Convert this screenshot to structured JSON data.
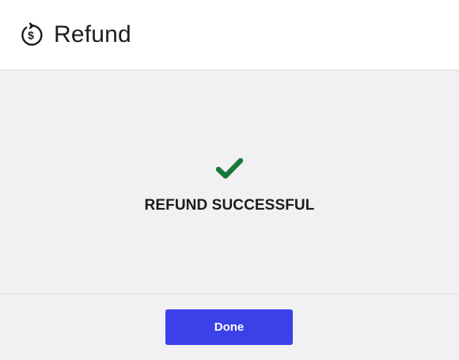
{
  "dialog": {
    "title": "Refund",
    "title_icon": "refund-dollar-icon",
    "status_icon": "checkmark-icon",
    "status_icon_color": "#17783a",
    "status_text": "REFUND SUCCESSFUL",
    "done_label": "Done",
    "accent_color": "#3b41e8"
  }
}
